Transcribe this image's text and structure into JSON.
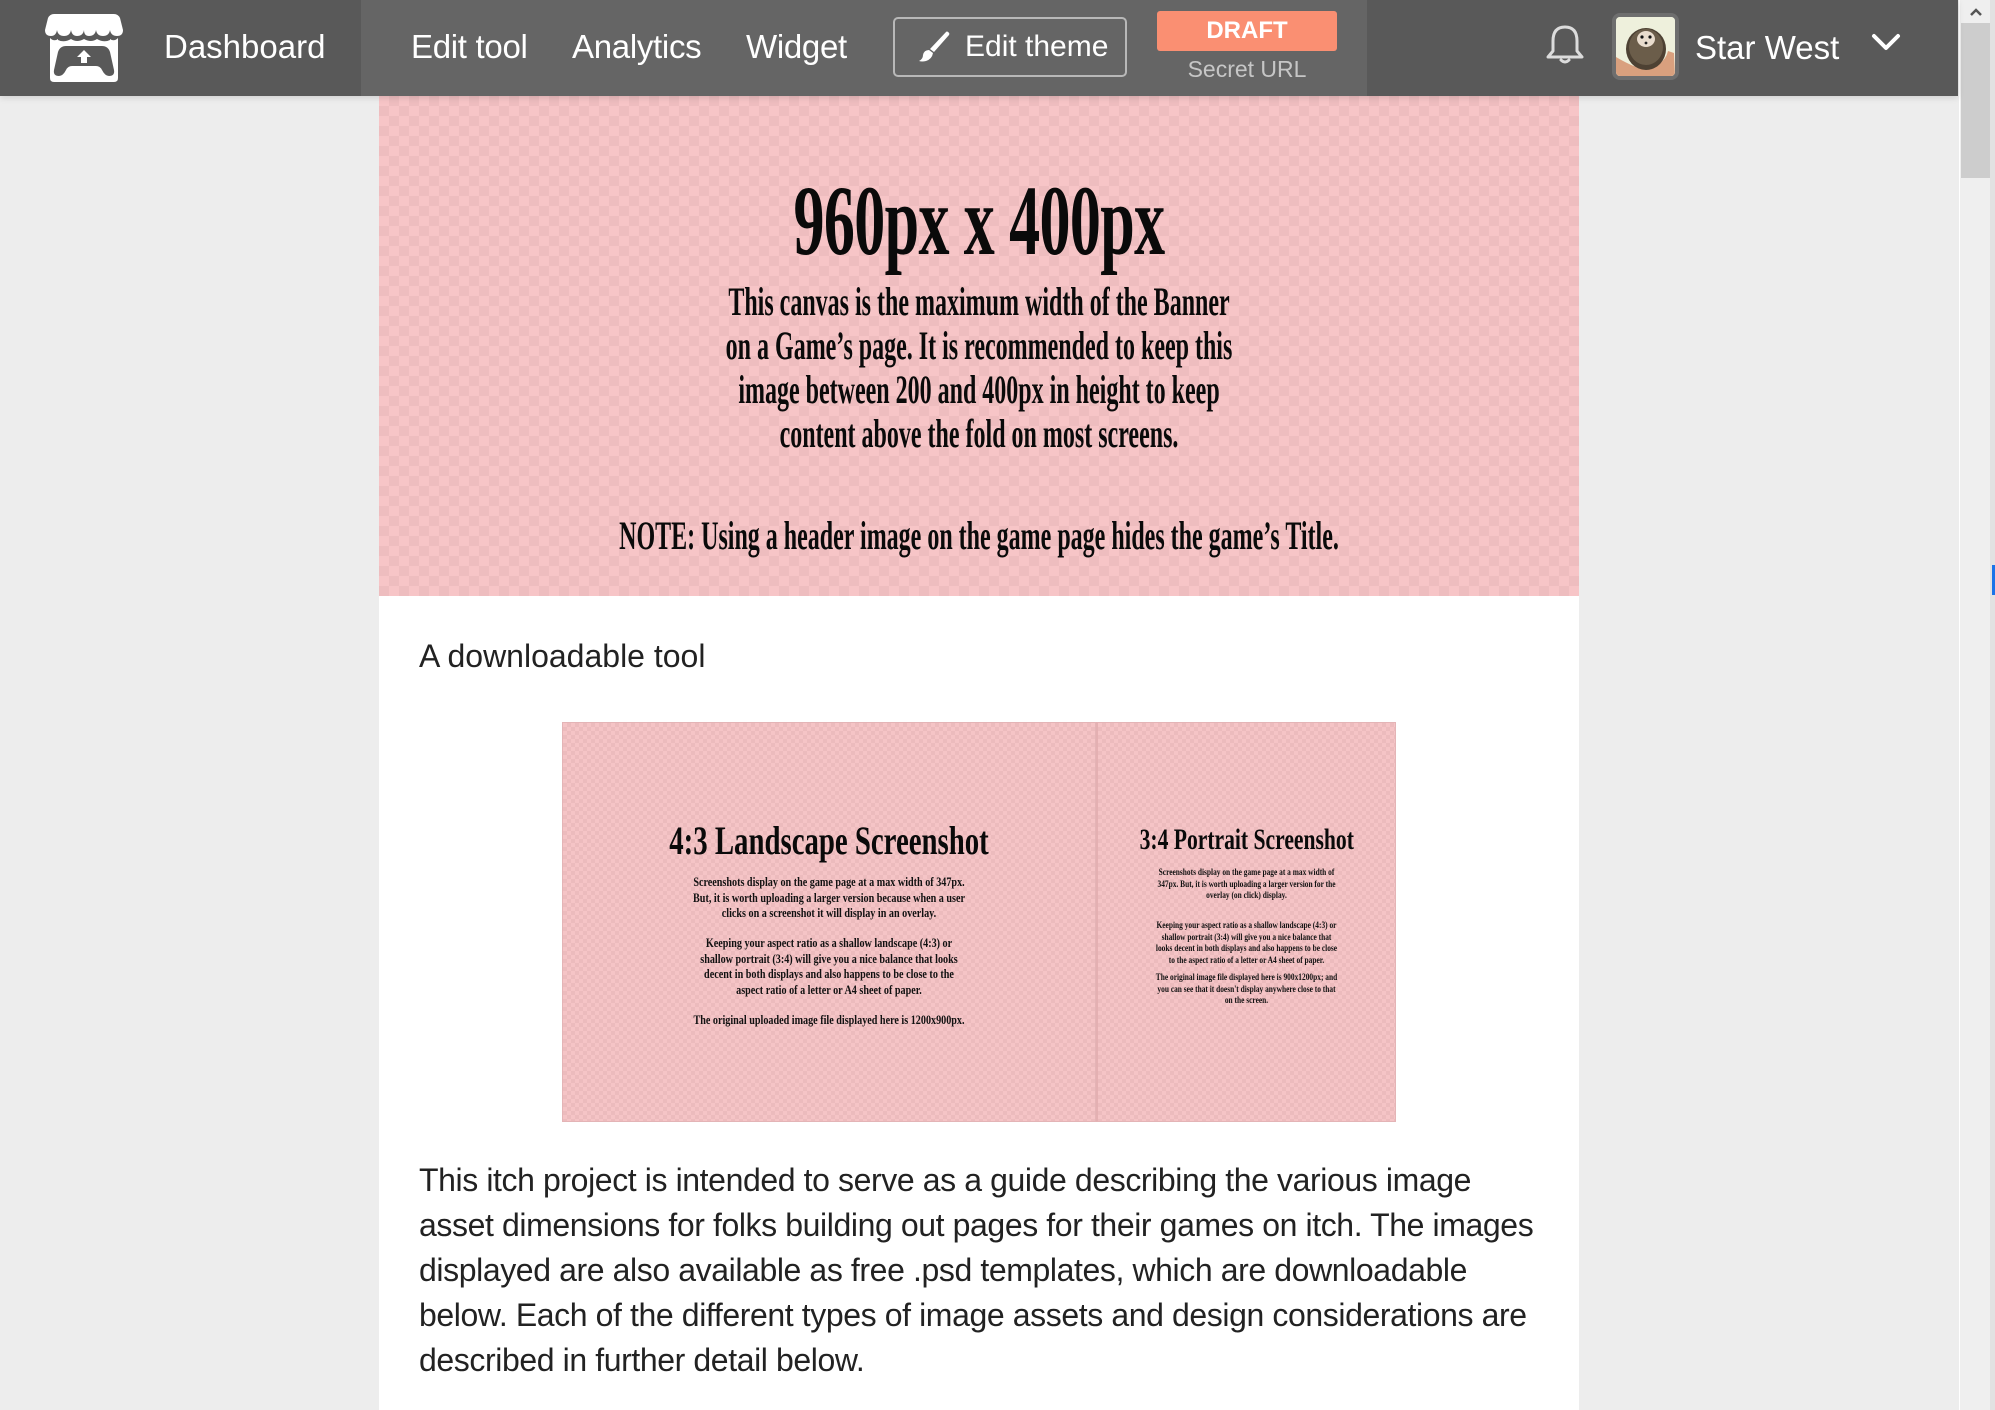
{
  "header": {
    "logo_icon": "itch-storefront-icon",
    "dashboard_label": "Dashboard",
    "nav": [
      {
        "label": "Edit tool"
      },
      {
        "label": "Analytics"
      },
      {
        "label": "Widget"
      }
    ],
    "edit_theme_label": "Edit theme",
    "edit_theme_icon": "paintbrush-icon",
    "status_badge": "DRAFT",
    "status_sublabel": "Secret URL",
    "status_color": "#fa8f72",
    "notifications_icon": "bell-icon",
    "user": {
      "name": "Star West",
      "avatar_icon": "hedgehog-avatar",
      "menu_icon": "chevron-down-icon"
    }
  },
  "banner": {
    "title": "960px x 400px",
    "body_lines": [
      "This canvas is the maximum width of the  Banner",
      "on a Game’s page. It is recommended to keep this",
      "image between 200 and 400px in height to keep",
      "content above the fold on most screens."
    ],
    "note": "NOTE: Using a header image on the game page hides the game’s Title."
  },
  "tagline": "A downloadable tool",
  "screenshots": [
    {
      "title": "4:3 Landscape Screenshot",
      "paragraphs": [
        [
          "Screenshots display on the game page at a max width of 347px.",
          "But, it is worth uploading a larger version because when a user",
          "clicks on a screenshot it will display in an overlay."
        ],
        [
          "Keeping your aspect ratio as a shallow landscape (4:3) or",
          "shallow portrait (3:4) will give you a nice balance that looks",
          "decent in both displays and also happens to be close to the",
          "aspect ratio of a letter or A4 sheet of paper."
        ],
        [
          "The original uploaded image file displayed here is 1200x900px."
        ]
      ]
    },
    {
      "title": "3:4 Portrait Screenshot",
      "paragraphs": [
        [
          "Screenshots display on the game page at a max width of",
          "347px. But, it is worth uploading a larger version for the",
          "overlay (on click) display."
        ],
        [
          "Keeping your aspect ratio as a shallow landscape (4:3) or",
          "shallow portrait (3:4) will give you a nice balance that",
          "looks decent in both displays and also happens to be close",
          "to the aspect ratio of a letter or A4 sheet of paper."
        ],
        [
          "The original image file displayed here is 900x1200px; and",
          "you can see that it doesn't display anywhere close to that",
          "on the screen."
        ]
      ]
    }
  ],
  "intro_lines": [
    "This itch project is intended to serve as a guide describing the various image",
    "asset dimensions for folks building out pages for their games on itch. The images",
    "displayed are also available as free .psd templates, which are downloadable",
    "below. Each of the different types of image assets and design considerations are",
    "described in further detail below."
  ],
  "scrollbar": {
    "up_icon": "scroll-up-arrow-icon"
  }
}
